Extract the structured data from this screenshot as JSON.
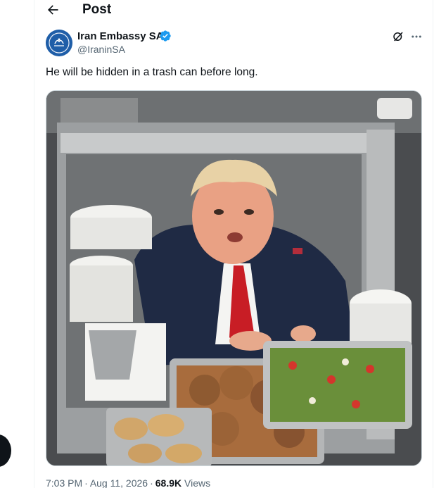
{
  "header": {
    "title": "Post",
    "back_icon": "arrow-left-icon"
  },
  "author": {
    "name": "Iran Embassy SA",
    "handle": "@IraninSA",
    "verified": true,
    "avatar_icon": "emblem-icon"
  },
  "tweet": {
    "text": "He will be hidden in a trash can before long."
  },
  "actions": {
    "grok_icon": "grok-icon",
    "more_icon": "more-icon"
  },
  "meta": {
    "time": "7:03 PM",
    "date": "Aug 11, 2026",
    "views_count": "68.9K",
    "views_label": "Views"
  },
  "colors": {
    "accent": "#1d9bf0",
    "text": "#0f1419",
    "muted": "#536471",
    "border": "#eff3f4"
  }
}
